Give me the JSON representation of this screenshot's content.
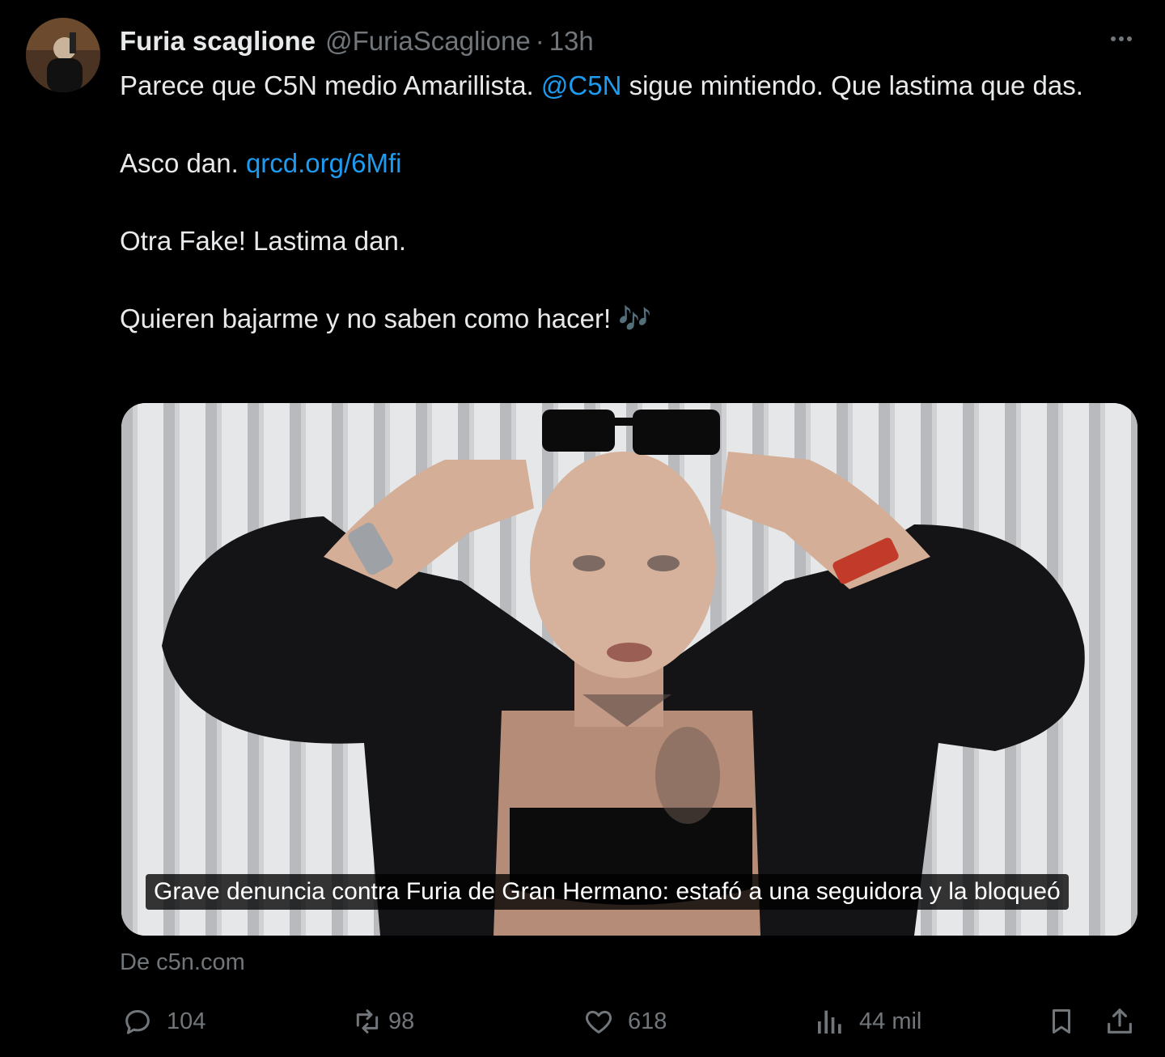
{
  "tweet": {
    "author": {
      "display_name": "Furia scaglione",
      "handle": "@FuriaScaglione",
      "separator": "·",
      "time": "13h"
    },
    "body": {
      "line1_text": "Parece que C5N medio Amarillista. ",
      "line1_mention": "@C5N",
      "line1_rest": " sigue mintiendo. Que lastima que das.",
      "line2_text": "Asco dan. ",
      "line2_link": "qrcd.org/6Mfi",
      "line3_text": "Otra Fake! Lastima dan.",
      "line4_text": "Quieren bajarme y no saben como hacer! ",
      "line4_emoji": "🎶"
    },
    "media": {
      "caption": "Grave denuncia contra Furia de Gran Hermano: estafó a una seguidora y la bloqueó"
    },
    "source": "De c5n.com",
    "actions": {
      "replies": "104",
      "reposts": "98",
      "likes": "618",
      "views": "44 mil"
    },
    "icons": {
      "reply": "reply-icon",
      "repost": "repost-icon",
      "like": "heart-icon",
      "views": "views-icon",
      "bookmark": "bookmark-icon",
      "share": "share-icon",
      "more": "more-icon"
    },
    "colors": {
      "background": "#000000",
      "text": "#e7e9ea",
      "muted": "#71767b",
      "link": "#1d9bf0"
    }
  }
}
